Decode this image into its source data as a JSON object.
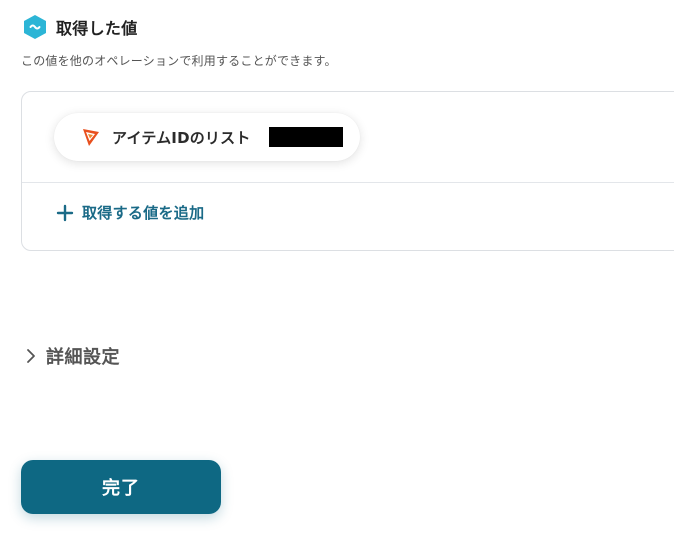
{
  "section": {
    "title": "取得した値",
    "description": "この値を他のオペレーションで利用することができます。",
    "icon": "app-badge-icon",
    "icon_color": "#2cb5d6"
  },
  "values": {
    "items": [
      {
        "label": "アイテムIDのリスト",
        "icon": "app-logo-icon",
        "icon_color": "#e8501e"
      }
    ],
    "add_label": "取得する値を追加",
    "add_icon": "plus-icon",
    "accent_color": "#1a6a87"
  },
  "advanced": {
    "label": "詳細設定",
    "icon": "chevron-right-icon"
  },
  "footer": {
    "done_label": "完了",
    "done_color": "#0e6883"
  }
}
